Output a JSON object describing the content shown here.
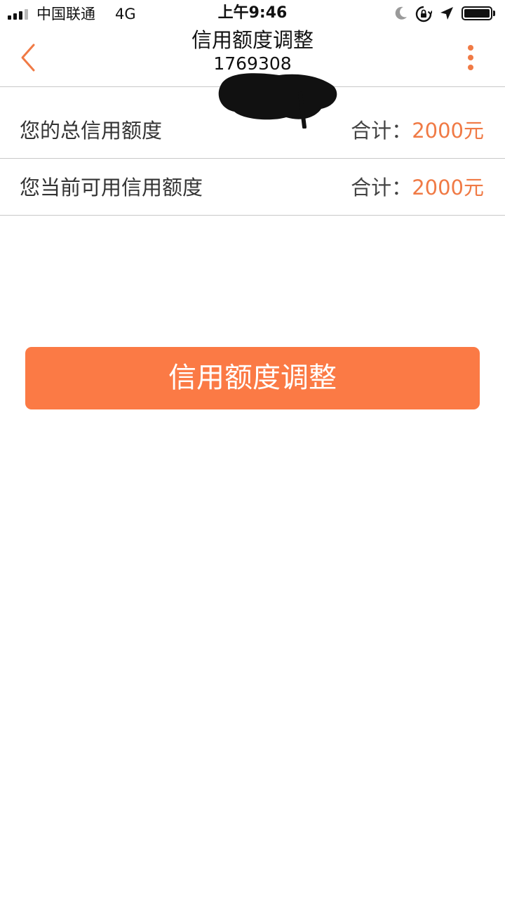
{
  "status_bar": {
    "carrier": "中国联通",
    "network": "4G",
    "time": "上午9:46",
    "icons": [
      "signal-icon",
      "moon-icon",
      "rotation-lock-icon",
      "location-icon",
      "battery-icon"
    ]
  },
  "header": {
    "title": "信用额度调整",
    "subtitle": "1769308",
    "icons": [
      "back-icon",
      "more-icon"
    ]
  },
  "credit": {
    "rows": [
      {
        "label": "您的总信用额度",
        "total_label": "合计：",
        "amount": "2000元"
      },
      {
        "label": "您当前可用信用额度",
        "total_label": "合计：",
        "amount": "2000元"
      }
    ]
  },
  "action": {
    "button_label": "信用额度调整"
  },
  "colors": {
    "accent": "#fb7a45",
    "amount": "#f07a45",
    "divider": "#c8c8c8"
  }
}
